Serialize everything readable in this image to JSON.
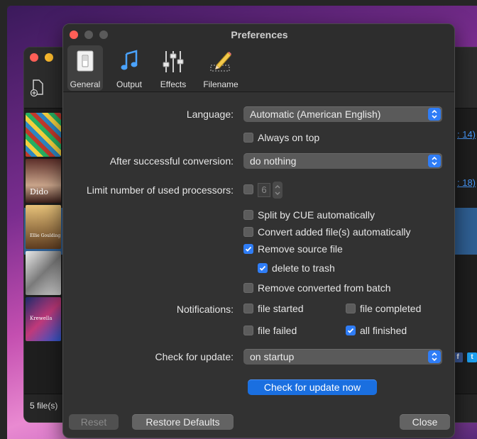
{
  "window": {
    "title": "Preferences"
  },
  "tabs": [
    {
      "label": "General",
      "icon": "switch-icon",
      "selected": true
    },
    {
      "label": "Output",
      "icon": "music-note-icon",
      "selected": false
    },
    {
      "label": "Effects",
      "icon": "sliders-icon",
      "selected": false
    },
    {
      "label": "Filename",
      "icon": "pencil-icon",
      "selected": false
    }
  ],
  "general": {
    "language_label": "Language:",
    "language_value": "Automatic (American English)",
    "always_on_top": {
      "label": "Always on top",
      "checked": false
    },
    "after_conversion_label": "After successful conversion:",
    "after_conversion_value": "do nothing",
    "processors_label": "Limit number of used processors:",
    "processors": {
      "checked": false,
      "value": "6"
    },
    "split_by_cue": {
      "label": "Split by CUE automatically",
      "checked": false
    },
    "convert_added": {
      "label": "Convert added file(s) automatically",
      "checked": false
    },
    "remove_source": {
      "label": "Remove source file",
      "checked": true
    },
    "delete_to_trash": {
      "label": "delete to trash",
      "checked": true
    },
    "remove_converted": {
      "label": "Remove converted from batch",
      "checked": false
    },
    "notifications_label": "Notifications:",
    "notify_file_started": {
      "label": "file started",
      "checked": false
    },
    "notify_file_completed": {
      "label": "file completed",
      "checked": false
    },
    "notify_file_failed": {
      "label": "file failed",
      "checked": false
    },
    "notify_all_finished": {
      "label": "all finished",
      "checked": true
    },
    "update_label": "Check for update:",
    "update_value": "on startup",
    "check_now_label": "Check for update now"
  },
  "footer": {
    "reset_label": "Reset",
    "restore_defaults_label": "Restore Defaults",
    "close_label": "Close"
  },
  "background_window": {
    "status_text": "5 file(s)",
    "link_1": ": 14)",
    "link_2": ": 18)",
    "cover_label_1": "Dido",
    "cover_label_2": "Ellie Goulding",
    "cover_label_3": "Krewella"
  },
  "colors": {
    "accent": "#2f7df6",
    "primary_button": "#1a6fe0",
    "window_bg": "#323232"
  }
}
